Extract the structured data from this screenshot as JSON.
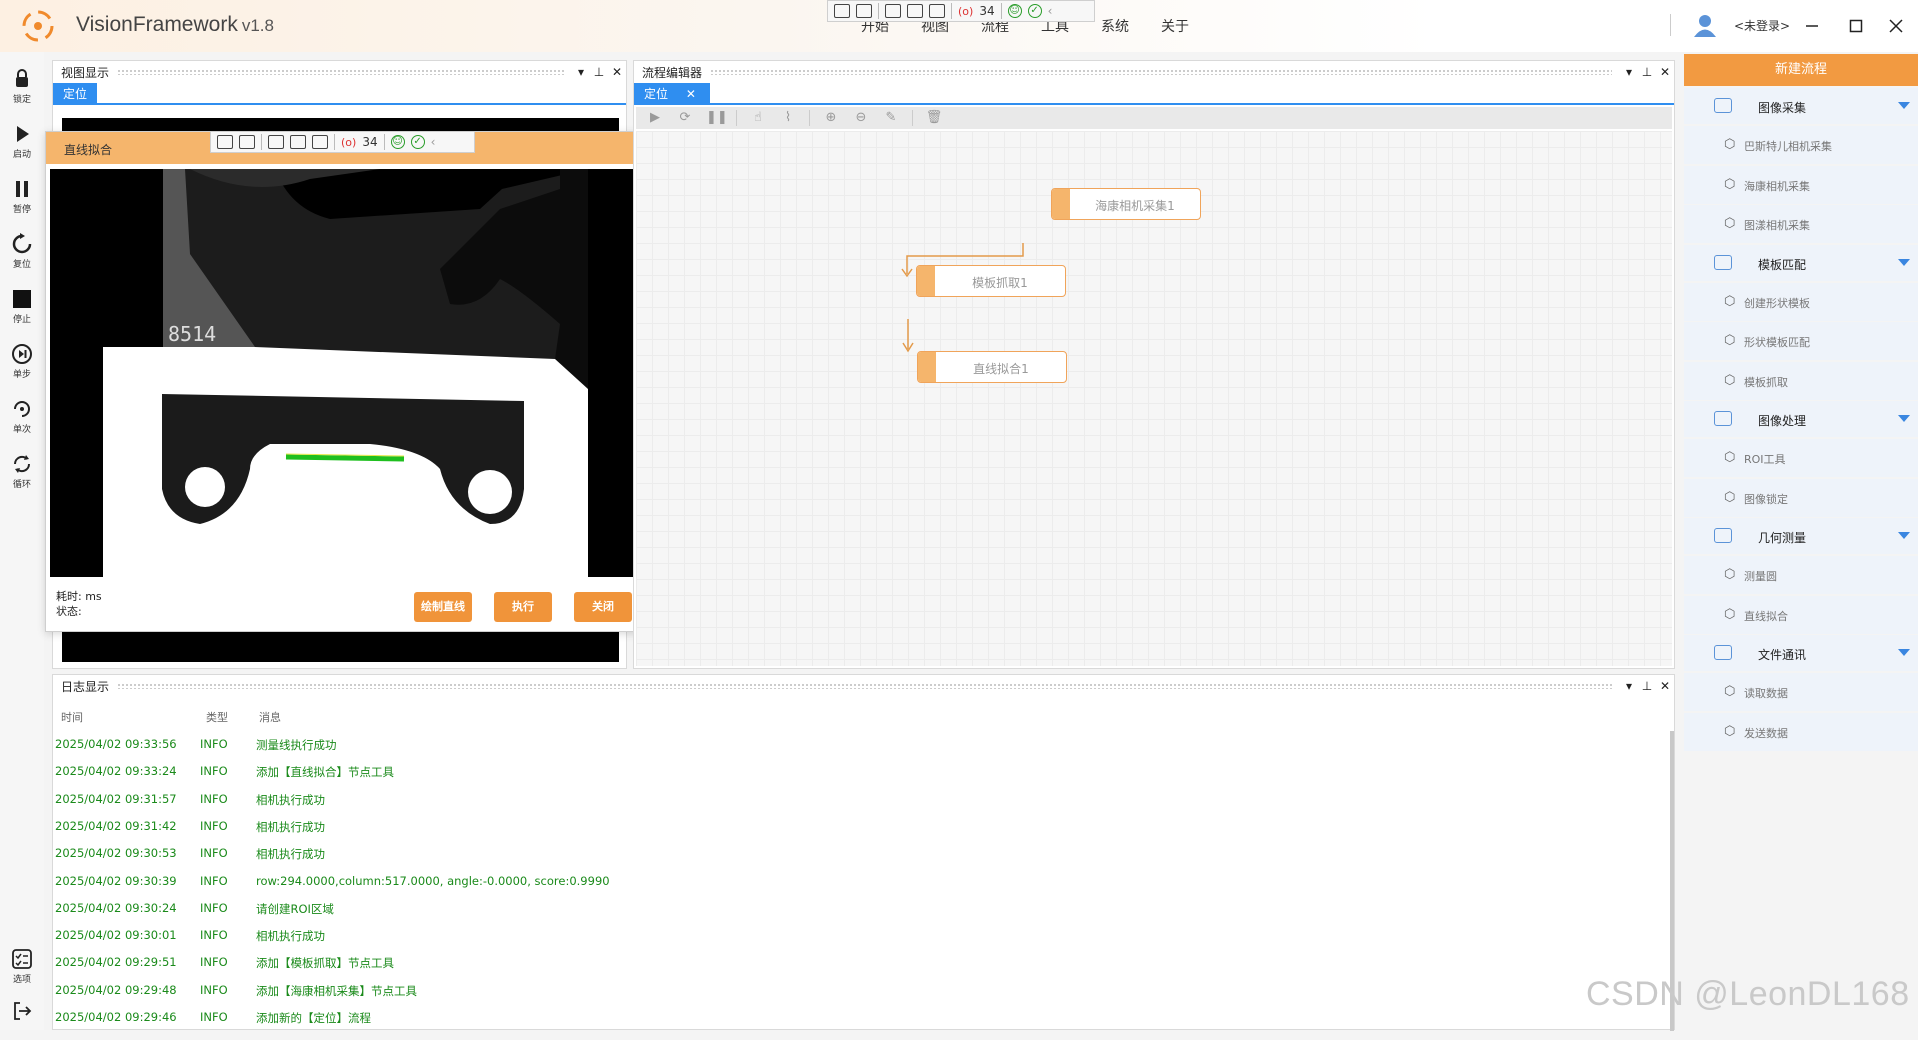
{
  "app": {
    "title": "VisionFramework",
    "version": "v1.8"
  },
  "menu": [
    "开始",
    "视图",
    "流程",
    "工具",
    "系统",
    "关于"
  ],
  "user": {
    "login_label": "<未登录>"
  },
  "floating_toolbar": {
    "record_count": "34"
  },
  "left_tools": [
    {
      "label": "锁定",
      "icon": "lock-icon"
    },
    {
      "label": "启动",
      "icon": "play-icon"
    },
    {
      "label": "暂停",
      "icon": "pause-icon"
    },
    {
      "label": "复位",
      "icon": "reset-icon"
    },
    {
      "label": "停止",
      "icon": "stop-icon"
    },
    {
      "label": "单步",
      "icon": "step-icon"
    },
    {
      "label": "单次",
      "icon": "once-icon"
    },
    {
      "label": "循环",
      "icon": "loop-icon"
    },
    {
      "label": "选项",
      "icon": "options-icon"
    },
    {
      "label": "",
      "icon": "logout-icon"
    }
  ],
  "view_panel": {
    "title": "视图显示",
    "tab": "定位"
  },
  "dialog": {
    "title": "直线拟合",
    "image_text": "8514",
    "time_label": "耗时:",
    "time_unit": "ms",
    "status_label": "状态:",
    "buttons": {
      "draw": "绘制直线",
      "execute": "执行",
      "close": "关闭"
    }
  },
  "flow_panel": {
    "title": "流程编辑器",
    "tab": "定位",
    "nodes": [
      "海康相机采集1",
      "模板抓取1",
      "直线拟合1"
    ]
  },
  "log_panel": {
    "title": "日志显示",
    "columns": {
      "time": "时间",
      "type": "类型",
      "message": "消息"
    },
    "rows": [
      {
        "time": "2025/04/02 09:33:56",
        "type": "INFO",
        "message": "测量线执行成功"
      },
      {
        "time": "2025/04/02 09:33:24",
        "type": "INFO",
        "message": "添加【直线拟合】节点工具"
      },
      {
        "time": "2025/04/02 09:31:57",
        "type": "INFO",
        "message": "相机执行成功"
      },
      {
        "time": "2025/04/02 09:31:42",
        "type": "INFO",
        "message": "相机执行成功"
      },
      {
        "time": "2025/04/02 09:30:53",
        "type": "INFO",
        "message": "相机执行成功"
      },
      {
        "time": "2025/04/02 09:30:39",
        "type": "INFO",
        "message": "row:294.0000,column:517.0000, angle:-0.0000, score:0.9990"
      },
      {
        "time": "2025/04/02 09:30:24",
        "type": "INFO",
        "message": "请创建ROI区域"
      },
      {
        "time": "2025/04/02 09:30:01",
        "type": "INFO",
        "message": "相机执行成功"
      },
      {
        "time": "2025/04/02 09:29:51",
        "type": "INFO",
        "message": "添加【模板抓取】节点工具"
      },
      {
        "time": "2025/04/02 09:29:48",
        "type": "INFO",
        "message": "添加【海康相机采集】节点工具"
      },
      {
        "time": "2025/04/02 09:29:46",
        "type": "INFO",
        "message": "添加新的【定位】流程"
      }
    ]
  },
  "library": {
    "new_flow": "新建流程",
    "categories": [
      {
        "label": "图像采集",
        "items": [
          "巴斯特儿相机采集",
          "海康相机采集",
          "图漾相机采集"
        ]
      },
      {
        "label": "模板匹配",
        "items": [
          "创建形状模板",
          "形状模板匹配",
          "模板抓取"
        ]
      },
      {
        "label": "图像处理",
        "items": [
          "ROI工具",
          "图像锁定"
        ]
      },
      {
        "label": "几何测量",
        "items": [
          "测量圆",
          "直线拟合"
        ]
      },
      {
        "label": "文件通讯",
        "items": [
          "读取数据",
          "发送数据"
        ]
      }
    ]
  },
  "watermark": "CSDN @LeonDL168",
  "colors": {
    "accent_orange": "#f29a41",
    "tab_blue": "#2f8ef0",
    "log_green": "#1a8a1a"
  }
}
